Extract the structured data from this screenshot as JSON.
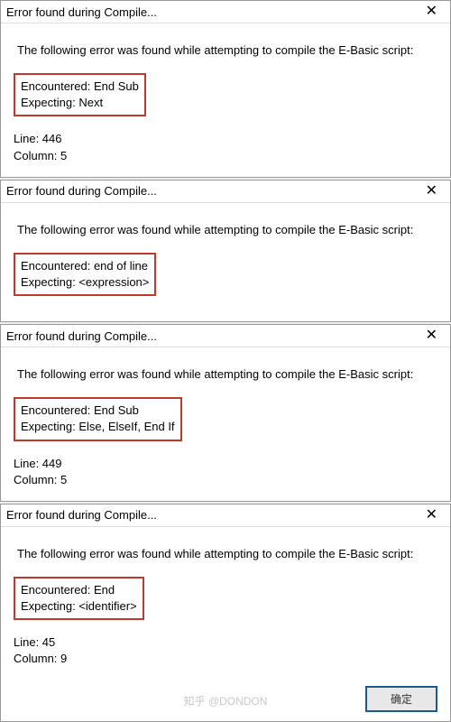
{
  "dialogs": [
    {
      "title": "Error found during Compile...",
      "intro": "The following error was found while attempting to compile the E-Basic script:",
      "encountered_label": "Encountered: ",
      "encountered_value": "End Sub",
      "expecting_label": "Expecting: ",
      "expecting_value": "Next",
      "line_text": "Line: 446",
      "column_text": "Column:   5",
      "show_location": true,
      "show_footer": false
    },
    {
      "title": "Error found during Compile...",
      "intro": "The following error was found while attempting to compile the E-Basic script:",
      "encountered_label": "Encountered: ",
      "encountered_value": "end of line",
      "expecting_label": "Expecting: ",
      "expecting_value": "<expression>",
      "line_text": "",
      "column_text": "",
      "show_location": false,
      "show_footer": false
    },
    {
      "title": "Error found during Compile...",
      "intro": "The following error was found while attempting to compile the E-Basic script:",
      "encountered_label": "Encountered: ",
      "encountered_value": "End Sub",
      "expecting_label": "Expecting: ",
      "expecting_value": "Else, ElseIf, End If",
      "line_text": "Line: 449",
      "column_text": "Column:   5",
      "show_location": true,
      "show_footer": false
    },
    {
      "title": "Error found during Compile...",
      "intro": "The following error was found while attempting to compile the E-Basic script:",
      "encountered_label": "Encountered: ",
      "encountered_value": "End",
      "expecting_label": "Expecting: ",
      "expecting_value": "<identifier>",
      "line_text": "Line: 45",
      "column_text": "Column:   9",
      "show_location": true,
      "show_footer": true
    }
  ],
  "ok_label": "确定",
  "watermark": "知乎 @DONDON"
}
